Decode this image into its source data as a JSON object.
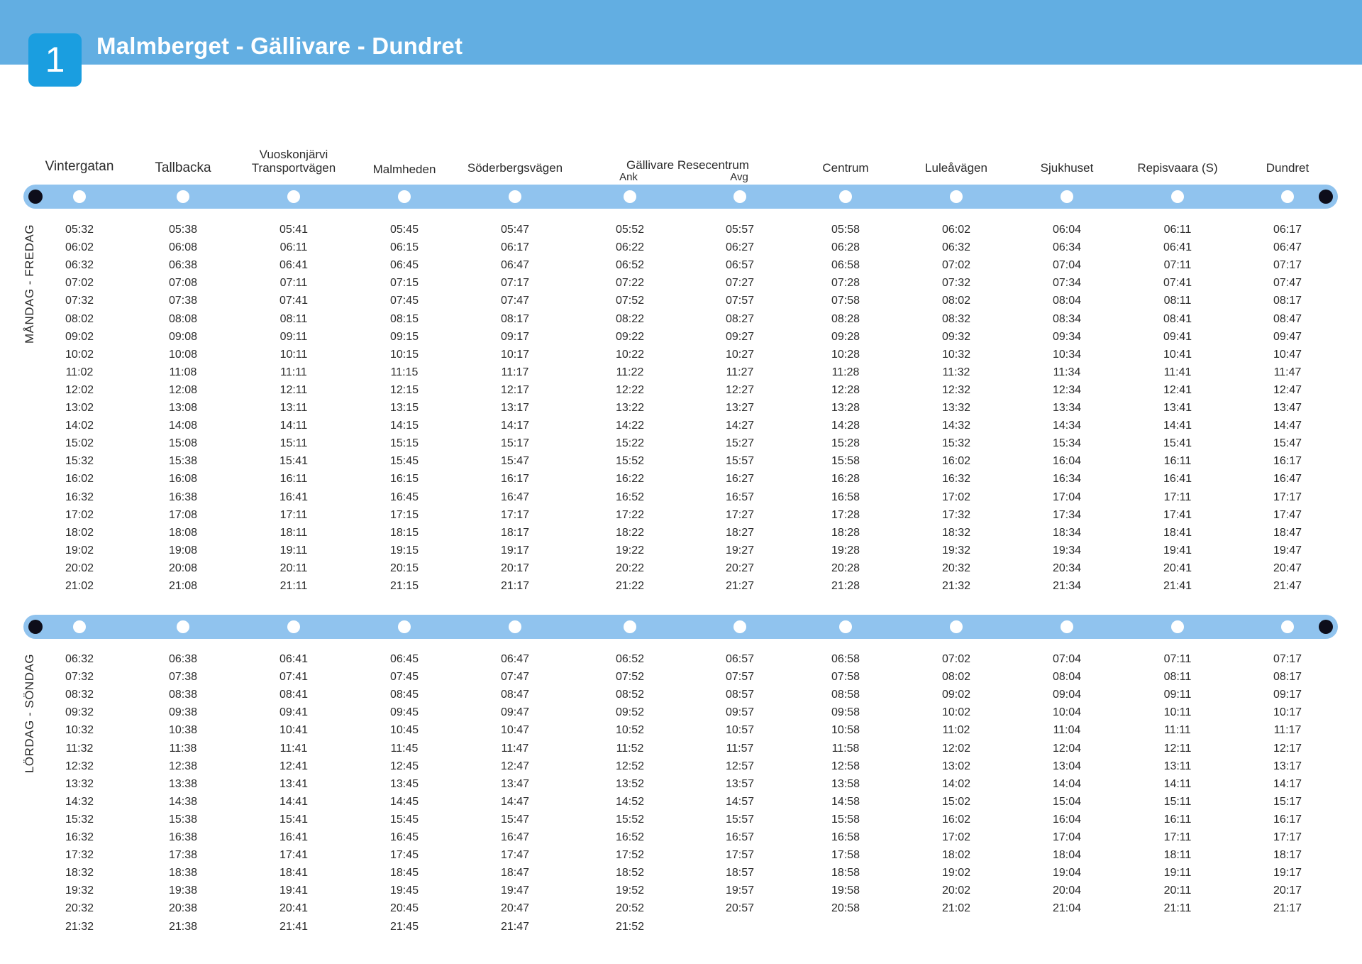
{
  "header": {
    "route_number": "1",
    "title": "Malmberget - Gällivare - Dundret",
    "color": "#62aee2",
    "badge_color": "#1a9ee0"
  },
  "stops": [
    {
      "name": "Vintergatan"
    },
    {
      "name": "Tallbacka"
    },
    {
      "name": "Vuoskonjärvi",
      "name2": "Transportvägen"
    },
    {
      "name": "Malmheden"
    },
    {
      "name": "Söderbergsvägen"
    },
    {
      "name": "Gällivare Resecentrum",
      "sub": "Ank"
    },
    {
      "name": "",
      "sub": "Avg"
    },
    {
      "name": "Centrum"
    },
    {
      "name": "Luleåvägen"
    },
    {
      "name": "Sjukhuset"
    },
    {
      "name": "Repisvaara (S)"
    },
    {
      "name": "Dundret"
    }
  ],
  "weekday": {
    "label": "MÅNDAG - FREDAG",
    "rows": [
      [
        "05:32",
        "05:38",
        "05:41",
        "05:45",
        "05:47",
        "05:52",
        "05:57",
        "05:58",
        "06:02",
        "06:04",
        "06:11",
        "06:17"
      ],
      [
        "06:02",
        "06:08",
        "06:11",
        "06:15",
        "06:17",
        "06:22",
        "06:27",
        "06:28",
        "06:32",
        "06:34",
        "06:41",
        "06:47"
      ],
      [
        "06:32",
        "06:38",
        "06:41",
        "06:45",
        "06:47",
        "06:52",
        "06:57",
        "06:58",
        "07:02",
        "07:04",
        "07:11",
        "07:17"
      ],
      [
        "07:02",
        "07:08",
        "07:11",
        "07:15",
        "07:17",
        "07:22",
        "07:27",
        "07:28",
        "07:32",
        "07:34",
        "07:41",
        "07:47"
      ],
      [
        "07:32",
        "07:38",
        "07:41",
        "07:45",
        "07:47",
        "07:52",
        "07:57",
        "07:58",
        "08:02",
        "08:04",
        "08:11",
        "08:17"
      ],
      [
        "08:02",
        "08:08",
        "08:11",
        "08:15",
        "08:17",
        "08:22",
        "08:27",
        "08:28",
        "08:32",
        "08:34",
        "08:41",
        "08:47"
      ],
      [
        "09:02",
        "09:08",
        "09:11",
        "09:15",
        "09:17",
        "09:22",
        "09:27",
        "09:28",
        "09:32",
        "09:34",
        "09:41",
        "09:47"
      ],
      [
        "10:02",
        "10:08",
        "10:11",
        "10:15",
        "10:17",
        "10:22",
        "10:27",
        "10:28",
        "10:32",
        "10:34",
        "10:41",
        "10:47"
      ],
      [
        "11:02",
        "11:08",
        "11:11",
        "11:15",
        "11:17",
        "11:22",
        "11:27",
        "11:28",
        "11:32",
        "11:34",
        "11:41",
        "11:47"
      ],
      [
        "12:02",
        "12:08",
        "12:11",
        "12:15",
        "12:17",
        "12:22",
        "12:27",
        "12:28",
        "12:32",
        "12:34",
        "12:41",
        "12:47"
      ],
      [
        "13:02",
        "13:08",
        "13:11",
        "13:15",
        "13:17",
        "13:22",
        "13:27",
        "13:28",
        "13:32",
        "13:34",
        "13:41",
        "13:47"
      ],
      [
        "14:02",
        "14:08",
        "14:11",
        "14:15",
        "14:17",
        "14:22",
        "14:27",
        "14:28",
        "14:32",
        "14:34",
        "14:41",
        "14:47"
      ],
      [
        "15:02",
        "15:08",
        "15:11",
        "15:15",
        "15:17",
        "15:22",
        "15:27",
        "15:28",
        "15:32",
        "15:34",
        "15:41",
        "15:47"
      ],
      [
        "15:32",
        "15:38",
        "15:41",
        "15:45",
        "15:47",
        "15:52",
        "15:57",
        "15:58",
        "16:02",
        "16:04",
        "16:11",
        "16:17"
      ],
      [
        "16:02",
        "16:08",
        "16:11",
        "16:15",
        "16:17",
        "16:22",
        "16:27",
        "16:28",
        "16:32",
        "16:34",
        "16:41",
        "16:47"
      ],
      [
        "16:32",
        "16:38",
        "16:41",
        "16:45",
        "16:47",
        "16:52",
        "16:57",
        "16:58",
        "17:02",
        "17:04",
        "17:11",
        "17:17"
      ],
      [
        "17:02",
        "17:08",
        "17:11",
        "17:15",
        "17:17",
        "17:22",
        "17:27",
        "17:28",
        "17:32",
        "17:34",
        "17:41",
        "17:47"
      ],
      [
        "18:02",
        "18:08",
        "18:11",
        "18:15",
        "18:17",
        "18:22",
        "18:27",
        "18:28",
        "18:32",
        "18:34",
        "18:41",
        "18:47"
      ],
      [
        "19:02",
        "19:08",
        "19:11",
        "19:15",
        "19:17",
        "19:22",
        "19:27",
        "19:28",
        "19:32",
        "19:34",
        "19:41",
        "19:47"
      ],
      [
        "20:02",
        "20:08",
        "20:11",
        "20:15",
        "20:17",
        "20:22",
        "20:27",
        "20:28",
        "20:32",
        "20:34",
        "20:41",
        "20:47"
      ],
      [
        "21:02",
        "21:08",
        "21:11",
        "21:15",
        "21:17",
        "21:22",
        "21:27",
        "21:28",
        "21:32",
        "21:34",
        "21:41",
        "21:47"
      ]
    ]
  },
  "weekend": {
    "label": "LÖRDAG - SÖNDAG",
    "rows": [
      [
        "06:32",
        "06:38",
        "06:41",
        "06:45",
        "06:47",
        "06:52",
        "06:57",
        "06:58",
        "07:02",
        "07:04",
        "07:11",
        "07:17"
      ],
      [
        "07:32",
        "07:38",
        "07:41",
        "07:45",
        "07:47",
        "07:52",
        "07:57",
        "07:58",
        "08:02",
        "08:04",
        "08:11",
        "08:17"
      ],
      [
        "08:32",
        "08:38",
        "08:41",
        "08:45",
        "08:47",
        "08:52",
        "08:57",
        "08:58",
        "09:02",
        "09:04",
        "09:11",
        "09:17"
      ],
      [
        "09:32",
        "09:38",
        "09:41",
        "09:45",
        "09:47",
        "09:52",
        "09:57",
        "09:58",
        "10:02",
        "10:04",
        "10:11",
        "10:17"
      ],
      [
        "10:32",
        "10:38",
        "10:41",
        "10:45",
        "10:47",
        "10:52",
        "10:57",
        "10:58",
        "11:02",
        "11:04",
        "11:11",
        "11:17"
      ],
      [
        "11:32",
        "11:38",
        "11:41",
        "11:45",
        "11:47",
        "11:52",
        "11:57",
        "11:58",
        "12:02",
        "12:04",
        "12:11",
        "12:17"
      ],
      [
        "12:32",
        "12:38",
        "12:41",
        "12:45",
        "12:47",
        "12:52",
        "12:57",
        "12:58",
        "13:02",
        "13:04",
        "13:11",
        "13:17"
      ],
      [
        "13:32",
        "13:38",
        "13:41",
        "13:45",
        "13:47",
        "13:52",
        "13:57",
        "13:58",
        "14:02",
        "14:04",
        "14:11",
        "14:17"
      ],
      [
        "14:32",
        "14:38",
        "14:41",
        "14:45",
        "14:47",
        "14:52",
        "14:57",
        "14:58",
        "15:02",
        "15:04",
        "15:11",
        "15:17"
      ],
      [
        "15:32",
        "15:38",
        "15:41",
        "15:45",
        "15:47",
        "15:52",
        "15:57",
        "15:58",
        "16:02",
        "16:04",
        "16:11",
        "16:17"
      ],
      [
        "16:32",
        "16:38",
        "16:41",
        "16:45",
        "16:47",
        "16:52",
        "16:57",
        "16:58",
        "17:02",
        "17:04",
        "17:11",
        "17:17"
      ],
      [
        "17:32",
        "17:38",
        "17:41",
        "17:45",
        "17:47",
        "17:52",
        "17:57",
        "17:58",
        "18:02",
        "18:04",
        "18:11",
        "18:17"
      ],
      [
        "18:32",
        "18:38",
        "18:41",
        "18:45",
        "18:47",
        "18:52",
        "18:57",
        "18:58",
        "19:02",
        "19:04",
        "19:11",
        "19:17"
      ],
      [
        "19:32",
        "19:38",
        "19:41",
        "19:45",
        "19:47",
        "19:52",
        "19:57",
        "19:58",
        "20:02",
        "20:04",
        "20:11",
        "20:17"
      ],
      [
        "20:32",
        "20:38",
        "20:41",
        "20:45",
        "20:47",
        "20:52",
        "20:57",
        "20:58",
        "21:02",
        "21:04",
        "21:11",
        "21:17"
      ],
      [
        "21:32",
        "21:38",
        "21:41",
        "21:45",
        "21:47",
        "21:52",
        "",
        "",
        "",
        "",
        "",
        ""
      ]
    ]
  }
}
